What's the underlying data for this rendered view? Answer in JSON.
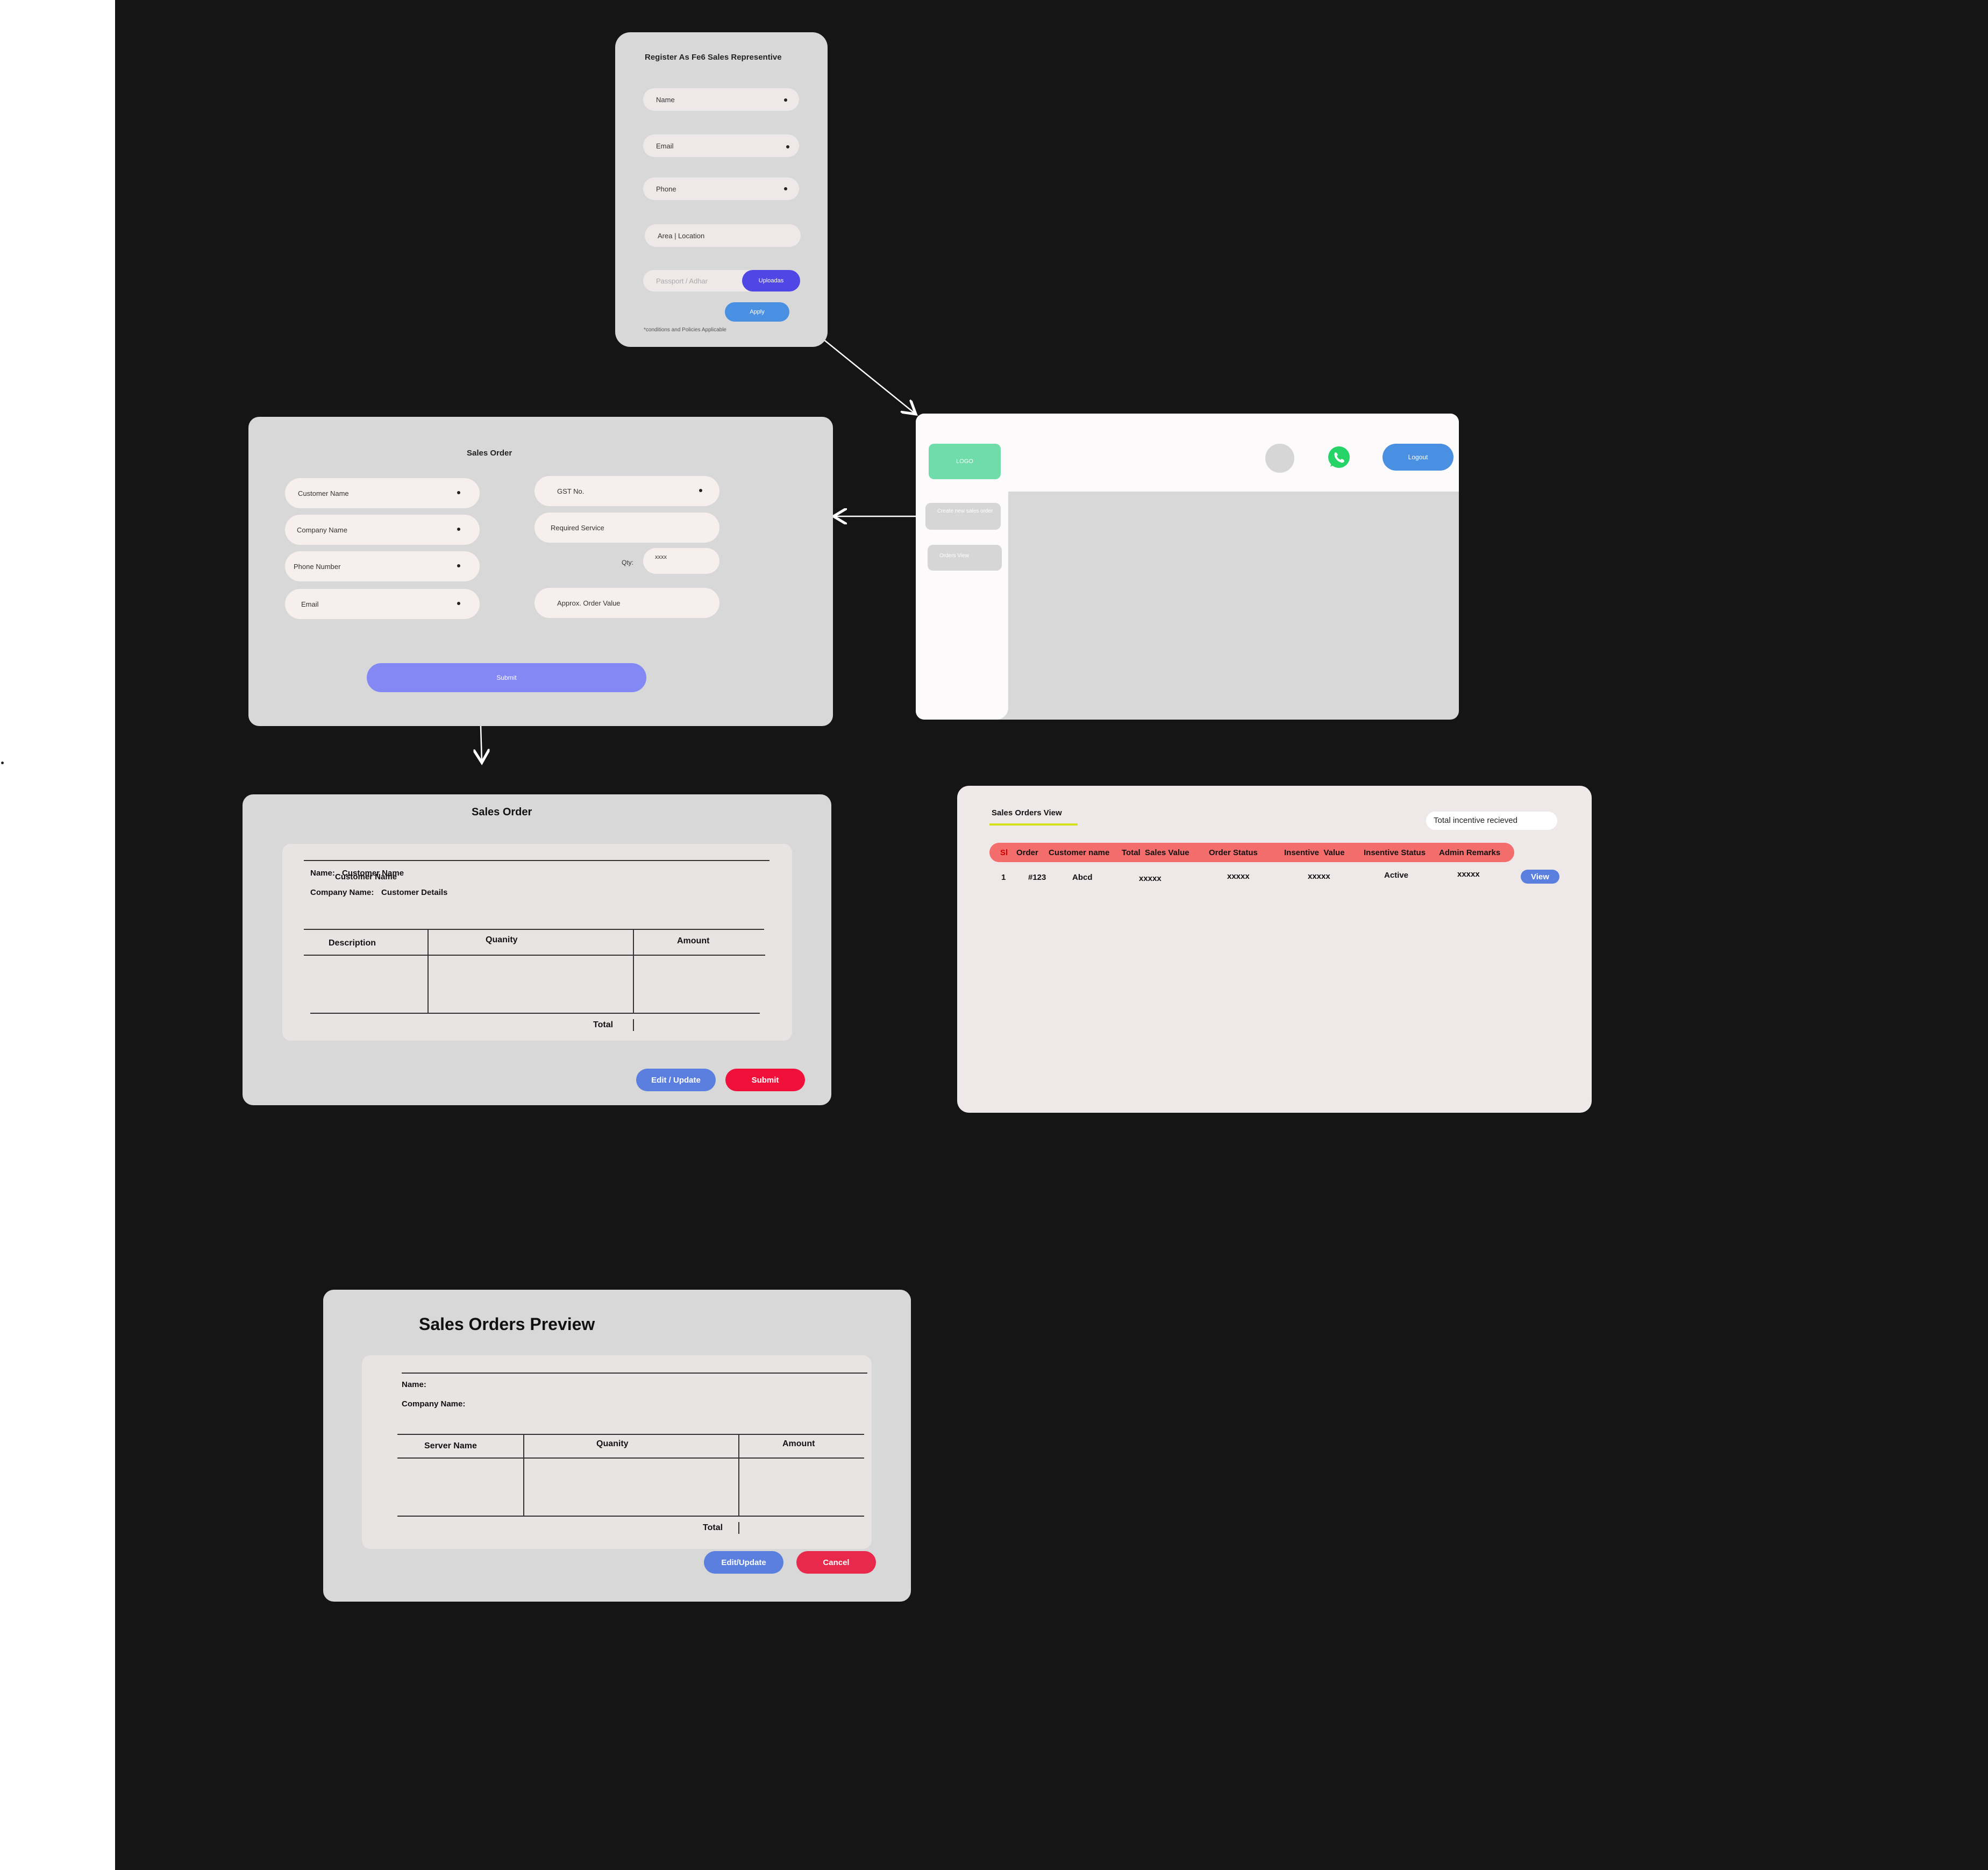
{
  "colors": {
    "canvas": "#151515",
    "frame_grey": "#d8d8d8",
    "field_light": "#f7eeee",
    "primary_blue": "#4a90e2",
    "indigo": "#4f46e5",
    "purple_btn": "#8388f5",
    "edit_blue": "#5b7fde",
    "red_submit": "#f0103a",
    "red_cancel": "#e8294b",
    "table_header_red": "#f46d6d",
    "logo_green": "#6fdcaa",
    "whatsapp_green": "#25d366",
    "accent_yellow": "#d4e21b"
  },
  "register": {
    "title": "Register As Fe6 Sales Representive",
    "fields": [
      {
        "label": "Name"
      },
      {
        "label": "Email"
      },
      {
        "label": "Phone"
      },
      {
        "label": "Area | Location"
      }
    ],
    "passport_placeholder": "Passport / Adhar",
    "upload_label": "Uploadas",
    "apply_label": "Apply",
    "footnote": "*conditions and Policies Applicable"
  },
  "dashboard": {
    "logo_label": "LOGO",
    "logout_label": "Logout",
    "menu": [
      {
        "label": "Create new sales order"
      },
      {
        "label": "Orders View"
      }
    ]
  },
  "sales_order_form": {
    "title": "Sales Order",
    "left_fields": [
      "Customer Name",
      "Company Name",
      "Phone  Number",
      "Email"
    ],
    "gst_label": "GST No.",
    "required_service_label": "Required Service",
    "qty_label": "Qty:",
    "qty_value": "xxxx",
    "approx_label": "Approx. Order Value",
    "submit_label": "Submit"
  },
  "sales_order_summary": {
    "title": "Sales Order",
    "name_label": "Name:",
    "name_value": "Customer Name",
    "name_value_overlap": "Customer Name",
    "company_label": "Company Name:",
    "company_value": "Customer  Details",
    "columns": [
      "Description",
      "Quanity",
      "Amount"
    ],
    "total_label": "Total",
    "edit_label": "Edit / Update",
    "submit_label": "Submit"
  },
  "orders_view": {
    "title": "Sales Orders View",
    "incentive_label": "Total incentive recieved",
    "columns": [
      "Sl",
      "Order",
      "Customer name",
      "Total  Sales Value",
      "Order Status",
      "Insentive  Value",
      "Insentive Status",
      "Admin Remarks"
    ],
    "rows": [
      {
        "sl": "1",
        "order": "#123",
        "customer": "Abcd",
        "sales_value": "xxxxx",
        "order_status": "xxxxx",
        "incentive_value": "xxxxx",
        "incentive_status": "Active",
        "remarks": "xxxxx"
      }
    ],
    "view_label": "View"
  },
  "preview": {
    "title": "Sales Orders Preview",
    "name_label": "Name:",
    "company_label": "Company Name:",
    "columns": [
      "Server Name",
      "Quanity",
      "Amount"
    ],
    "total_label": "Total",
    "edit_label": "Edit/Update",
    "cancel_label": "Cancel"
  }
}
